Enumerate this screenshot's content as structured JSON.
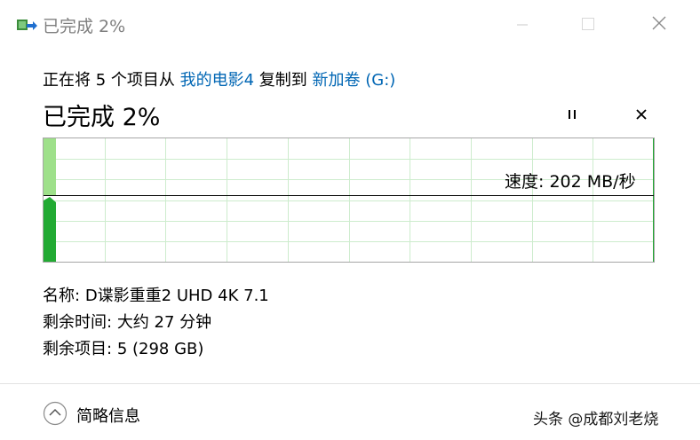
{
  "window": {
    "title": "已完成 2%",
    "icon": "file-copy-icon",
    "controls": [
      "minimize-icon",
      "maximize-icon",
      "close-icon"
    ]
  },
  "copy_line": {
    "prefix": "正在将 5 个项目从 ",
    "source": "我的电影4",
    "middle": " 复制到 ",
    "destination": "新加卷 (G:)"
  },
  "status": {
    "title": "已完成 2%",
    "progress_percent": 2
  },
  "graph": {
    "speed_text": "速度: 202 MB/秒",
    "speed_line_fraction": 0.46,
    "bar_fill_fraction": 0.02
  },
  "details": {
    "name_label": "名称:",
    "name_value": "D谍影重重2 UHD 4K 7.1",
    "time_label": "剩余时间:",
    "time_value": "大约 27 分钟",
    "items_label": "剩余项目:",
    "items_value": "5 (298 GB)"
  },
  "footer": {
    "toggle_label": "简略信息",
    "toggle_icon": "chevron-up-icon"
  },
  "watermark": "头条 @成都刘老烧",
  "colors": {
    "link": "#0066b4",
    "graph_green": "#22aa33",
    "graph_light_green": "#9ee08a",
    "graph_grid": "#cdeccd"
  }
}
